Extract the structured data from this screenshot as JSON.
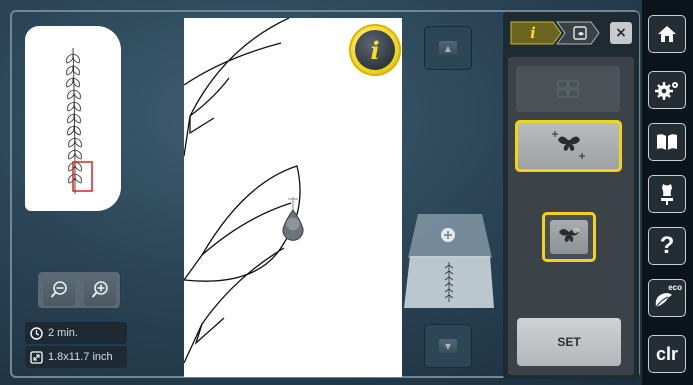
{
  "overview": {
    "label": "design-overview"
  },
  "info": {
    "time": "2 min.",
    "size": "1.8x11.7 inch"
  },
  "info_badge": {
    "letter": "i"
  },
  "tabs": {
    "info_tab": "i",
    "close": "×"
  },
  "buttons": {
    "set": "SET"
  },
  "sidebar": {
    "eco_label": "eco",
    "clr_label": "clr",
    "help_label": "?"
  },
  "colors": {
    "accent": "#f2d21e",
    "background": "#2a4456",
    "panel": "#3b4348"
  },
  "icons": [
    "zoom-out-icon",
    "zoom-in-icon",
    "clock-icon",
    "resize-icon",
    "info-icon",
    "arrow-up-icon",
    "arrow-down-icon",
    "hoop-icon",
    "recenter-icon",
    "mirror-icon",
    "home-icon",
    "settings-icon",
    "book-icon",
    "dress-form-icon",
    "help-icon",
    "eco-icon",
    "clear-icon"
  ]
}
